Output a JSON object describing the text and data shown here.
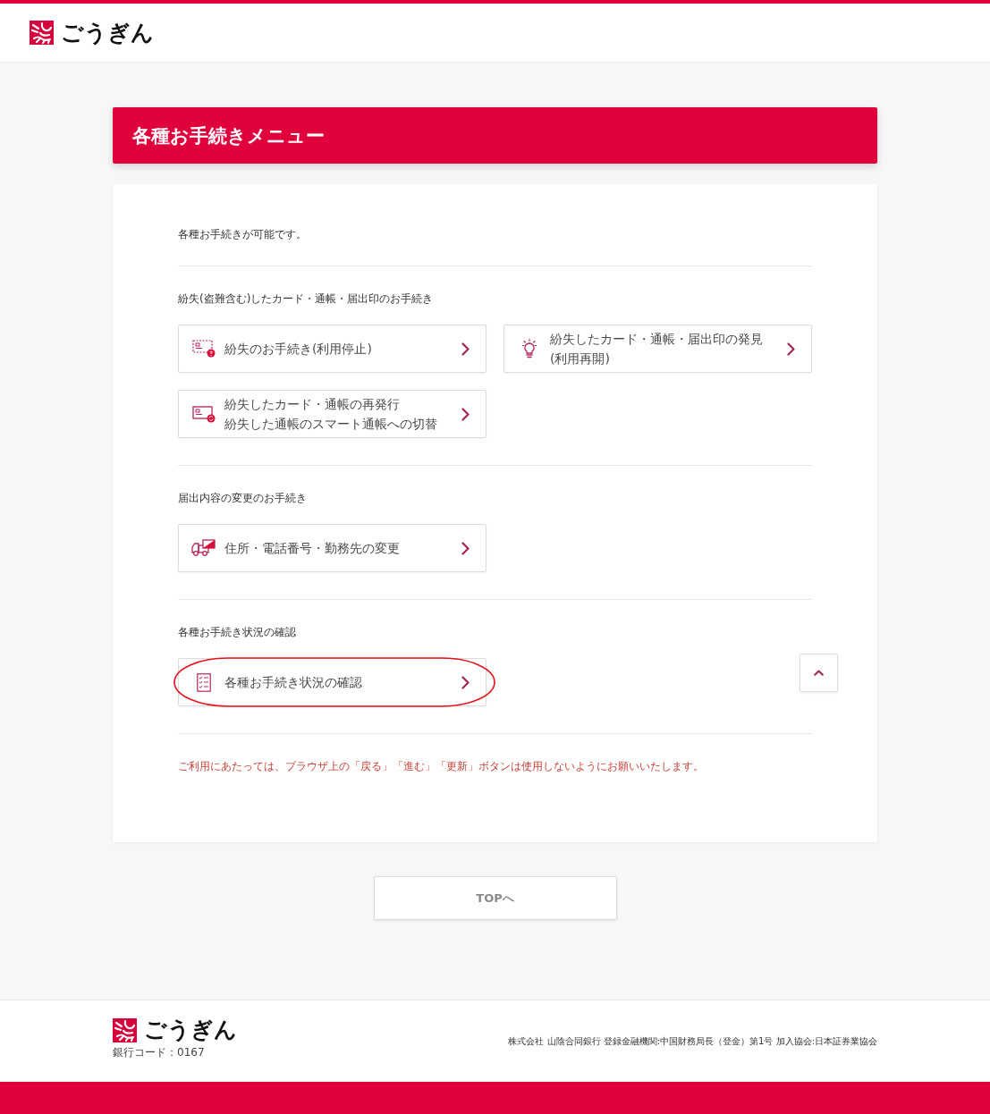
{
  "header": {
    "logo_text": "ごうぎん"
  },
  "page_title": "各種お手続きメニュー",
  "intro": "各種お手続きが可能です。",
  "sections": [
    {
      "heading": "紛失(盗難含む)したカード・通帳・届出印のお手続き",
      "items": [
        {
          "kind": "lost",
          "lines": [
            "紛失のお手続き(利用停止)"
          ],
          "circled": false
        },
        {
          "kind": "found",
          "lines": [
            "紛失したカード・通帳・届出印の発見",
            "(利用再開)"
          ],
          "circled": false
        },
        {
          "kind": "reissue",
          "lines": [
            "紛失したカード・通帳の再発行",
            "紛失した通帳のスマート通帳への切替"
          ],
          "circled": false
        }
      ]
    },
    {
      "heading": "届出内容の変更のお手続き",
      "items": [
        {
          "kind": "change",
          "lines": [
            "住所・電話番号・勤務先の変更"
          ],
          "circled": false
        }
      ]
    },
    {
      "heading": "各種お手続き状況の確認",
      "items": [
        {
          "kind": "status",
          "lines": [
            "各種お手続き状況の確認"
          ],
          "circled": true
        }
      ]
    }
  ],
  "notice": "ご利用にあたっては、ブラウザ上の「戻る」「進む」「更新」ボタンは使用しないようにお願いいたします。",
  "top_button": "TOPへ",
  "footer": {
    "logo_text": "ごうぎん",
    "bank_code": "銀行コード：0167",
    "company_info": "株式会社 山陰合同銀行 登録金融機関:中国財務局長（登金）第1号 加入協会:日本証券業協会"
  }
}
